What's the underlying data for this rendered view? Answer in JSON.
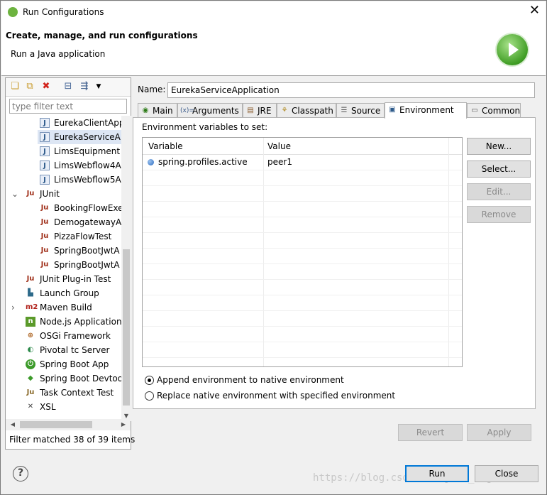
{
  "window": {
    "title": "Run Configurations",
    "close_glyph": "✕"
  },
  "banner": {
    "heading": "Create, manage, and run configurations",
    "subheading": "Run a Java application"
  },
  "left_toolbar": {
    "icons": [
      "new-config-icon",
      "duplicate-icon",
      "delete-icon",
      "collapse-all-icon",
      "filter-icon",
      "view-menu-icon"
    ]
  },
  "filter": {
    "placeholder": "type filter text",
    "value": ""
  },
  "tree": {
    "items": [
      {
        "label": "EurekaClientApp",
        "icon": "java-app-icon"
      },
      {
        "label": "EurekaServiceA",
        "icon": "java-app-icon",
        "selected": true
      },
      {
        "label": "LimsEquipment",
        "icon": "java-app-icon"
      },
      {
        "label": "LimsWebflow4A",
        "icon": "java-app-icon"
      },
      {
        "label": "LimsWebflow5A",
        "icon": "java-app-icon"
      },
      {
        "label": "JUnit",
        "icon": "junit-icon",
        "expandable": true,
        "expanded": true
      },
      {
        "label": "BookingFlowExe",
        "icon": "junit-icon"
      },
      {
        "label": "DemogatewayA",
        "icon": "junit-icon"
      },
      {
        "label": "PizzaFlowTest",
        "icon": "junit-icon"
      },
      {
        "label": "SpringBootJwtA",
        "icon": "junit-icon"
      },
      {
        "label": "SpringBootJwtA",
        "icon": "junit-icon"
      },
      {
        "label": "JUnit Plug-in Test",
        "icon": "junit-plugin-icon"
      },
      {
        "label": "Launch Group",
        "icon": "launch-group-icon"
      },
      {
        "label": "Maven Build",
        "icon": "maven-icon",
        "expandable": true,
        "expanded": false
      },
      {
        "label": "Node.js Application",
        "icon": "nodejs-icon"
      },
      {
        "label": "OSGi Framework",
        "icon": "osgi-icon"
      },
      {
        "label": "Pivotal tc Server",
        "icon": "pivotal-icon"
      },
      {
        "label": "Spring Boot App",
        "icon": "spring-boot-icon"
      },
      {
        "label": "Spring Boot Devtools",
        "icon": "spring-devtools-icon"
      },
      {
        "label": "Task Context Test",
        "icon": "task-context-icon"
      },
      {
        "label": "XSL",
        "icon": "xsl-icon"
      }
    ],
    "expander_expanded": "⌄",
    "expander_collapsed": "›"
  },
  "filter_status": "Filter matched 38 of 39 items",
  "config": {
    "name_label": "Name:",
    "name_value": "EurekaServiceApplication",
    "tabs": [
      {
        "label": "Main",
        "icon": "main-tab-icon"
      },
      {
        "label": "Arguments",
        "icon": "arguments-tab-icon"
      },
      {
        "label": "JRE",
        "icon": "jre-tab-icon"
      },
      {
        "label": "Classpath",
        "icon": "classpath-tab-icon"
      },
      {
        "label": "Source",
        "icon": "source-tab-icon"
      },
      {
        "label": "Environment",
        "icon": "environment-tab-icon",
        "active": true
      },
      {
        "label": "Common",
        "icon": "common-tab-icon"
      }
    ],
    "env_label": "Environment variables to set:",
    "columns": [
      "Variable",
      "Value"
    ],
    "rows": [
      {
        "variable": "spring.profiles.active",
        "value": "peer1"
      }
    ],
    "side_buttons": [
      {
        "label": "New...",
        "enabled": true
      },
      {
        "label": "Select...",
        "enabled": true
      },
      {
        "label": "Edit...",
        "enabled": false
      },
      {
        "label": "Remove",
        "enabled": false
      }
    ],
    "radio_append": {
      "label": "Append environment to native environment",
      "checked": true
    },
    "radio_replace": {
      "label": "Replace native environment with specified environment",
      "checked": false
    },
    "revert_label": "Revert",
    "apply_label": "Apply"
  },
  "footer": {
    "help_glyph": "?",
    "run_label": "Run",
    "close_label": "Close",
    "watermark": "https://blog.csdn.net/java_augur"
  }
}
